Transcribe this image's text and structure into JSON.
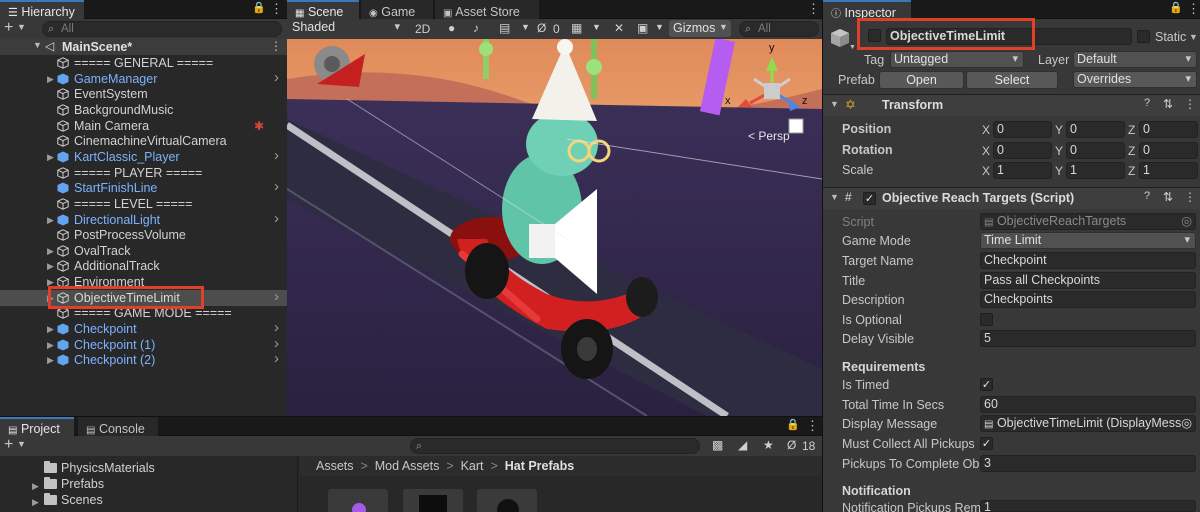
{
  "hierarchy": {
    "tab_label": "Hierarchy",
    "search_placeholder": "All",
    "scene_name": "MainScene*",
    "items": [
      {
        "label": "===== GENERAL =====",
        "prefab": false,
        "fold": false,
        "chevron": false
      },
      {
        "label": "GameManager",
        "prefab": true,
        "fold": true,
        "chevron": true
      },
      {
        "label": "EventSystem",
        "prefab": false,
        "fold": false,
        "chevron": false
      },
      {
        "label": "BackgroundMusic",
        "prefab": false,
        "fold": false,
        "chevron": false
      },
      {
        "label": "Main Camera",
        "prefab": false,
        "fold": false,
        "chevron": false,
        "badge": "camera-bug-icon"
      },
      {
        "label": "CinemachineVirtualCamera",
        "prefab": false,
        "fold": false,
        "chevron": false
      },
      {
        "label": "KartClassic_Player",
        "prefab": true,
        "fold": true,
        "chevron": true
      },
      {
        "label": "===== PLAYER =====",
        "prefab": false,
        "fold": false,
        "chevron": false
      },
      {
        "label": "StartFinishLine",
        "prefab": true,
        "fold": false,
        "chevron": true
      },
      {
        "label": "===== LEVEL =====",
        "prefab": false,
        "fold": false,
        "chevron": false
      },
      {
        "label": "DirectionalLight",
        "prefab": true,
        "fold": true,
        "chevron": true
      },
      {
        "label": "PostProcessVolume",
        "prefab": false,
        "fold": false,
        "chevron": false
      },
      {
        "label": "OvalTrack",
        "prefab": false,
        "fold": true,
        "chevron": false
      },
      {
        "label": "AdditionalTrack",
        "prefab": false,
        "fold": true,
        "chevron": false
      },
      {
        "label": "Environment",
        "prefab": false,
        "fold": true,
        "chevron": false
      },
      {
        "label": "ObjectiveTimeLimit",
        "prefab": false,
        "fold": true,
        "chevron": true,
        "selected": true
      },
      {
        "label": "===== GAME MODE =====",
        "prefab": false,
        "fold": false,
        "chevron": false
      },
      {
        "label": "Checkpoint",
        "prefab": true,
        "fold": true,
        "chevron": true
      },
      {
        "label": "Checkpoint (1)",
        "prefab": true,
        "fold": true,
        "chevron": true
      },
      {
        "label": "Checkpoint (2)",
        "prefab": true,
        "fold": true,
        "chevron": true
      }
    ]
  },
  "scene": {
    "tabs": [
      {
        "label": "Scene",
        "icon": "scene-grid-icon"
      },
      {
        "label": "Game",
        "icon": "gamepad-icon"
      },
      {
        "label": "Asset Store",
        "icon": "shopping-bag-icon"
      }
    ],
    "shading_mode": "Shaded",
    "mode_2d": "2D",
    "hidden_count": "0",
    "gizmos_label": "Gizmos",
    "search_placeholder": "All",
    "gizmo_axes": {
      "x": "x",
      "y": "y",
      "z": "z"
    },
    "projection_label": "< Persp"
  },
  "project": {
    "tabs": [
      {
        "label": "Project",
        "icon": "folder-icon"
      },
      {
        "label": "Console",
        "icon": "console-icon"
      }
    ],
    "tree": [
      "PhysicsMaterials",
      "Prefabs",
      "Scenes"
    ],
    "breadcrumb": [
      "Assets",
      "Mod Assets",
      "Kart",
      "Hat Prefabs"
    ],
    "hidden_count": "18"
  },
  "inspector": {
    "tab_label": "Inspector",
    "object_name": "ObjectiveTimeLimit",
    "static_label": "Static",
    "tag_label": "Tag",
    "tag_value": "Untagged",
    "layer_label": "Layer",
    "layer_value": "Default",
    "prefab_label": "Prefab",
    "open_label": "Open",
    "select_label": "Select",
    "overrides_label": "Overrides",
    "transform": {
      "title": "Transform",
      "rows": [
        {
          "label": "Position",
          "x": "0",
          "y": "0",
          "z": "0"
        },
        {
          "label": "Rotation",
          "x": "0",
          "y": "0",
          "z": "0"
        },
        {
          "label": "Scale",
          "x": "1",
          "y": "1",
          "z": "1"
        }
      ]
    },
    "script_component": {
      "title": "Objective Reach Targets (Script)",
      "script_label": "Script",
      "script_value": "ObjectiveReachTargets",
      "game_mode_label": "Game Mode",
      "game_mode_value": "Time Limit",
      "target_name_label": "Target Name",
      "target_name_value": "Checkpoint",
      "title_label": "Title",
      "title_value": "Pass all Checkpoints",
      "description_label": "Description",
      "description_value": "Checkpoints",
      "is_optional_label": "Is Optional",
      "is_optional_checked": false,
      "delay_visible_label": "Delay Visible",
      "delay_visible_value": "5",
      "requirements_header": "Requirements",
      "is_timed_label": "Is Timed",
      "is_timed_checked": true,
      "total_time_label": "Total Time In Secs",
      "total_time_value": "60",
      "display_message_label": "Display Message",
      "display_message_value": "ObjectiveTimeLimit (DisplayMess",
      "must_collect_label": "Must Collect All Pickups",
      "must_collect_checked": true,
      "pickups_label": "Pickups To Complete Ob",
      "pickups_value": "3",
      "notification_header": "Notification",
      "notification_label": "Notification Pickups Rem",
      "notification_value": "1"
    }
  },
  "colors": {
    "accent": "#3a79bb",
    "prefab_text": "#7cb3ff",
    "highlight_box": "#e0402a"
  }
}
